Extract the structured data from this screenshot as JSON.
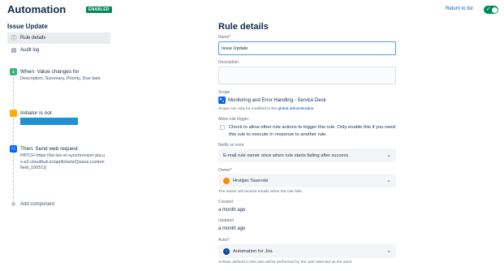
{
  "header": {
    "title": "Automation",
    "status_badge": "ENABLED",
    "return_link": "Return to list",
    "toggle_icon": "check-icon",
    "colors": {
      "accent": "#00875a",
      "link": "#0052cc"
    }
  },
  "sidebar": {
    "rule_name": "Issue Update",
    "nav": [
      {
        "label": "Rule details",
        "icon": "info-icon",
        "active": true
      },
      {
        "label": "Audit log",
        "icon": "document-icon",
        "active": false
      }
    ],
    "components": [
      {
        "title": "When: Value changes for",
        "desc": "Description, Summary, Priority, Due date",
        "icon_color": "#36b37e"
      },
      {
        "title": "Initiator is not",
        "icon_color": "#ffab00"
      },
      {
        "title": "Then: Send web request",
        "desc": "PATCH https://tst-iwc-el-synchronizer-jira.us-e2.cloudhub.io/api/tickets/{{issue.customfield_10051}}",
        "icon_color": "#0065ff"
      }
    ],
    "add_component": "Add component"
  },
  "form": {
    "heading": "Rule details",
    "name_label": "Name",
    "name_value": "Issue Update",
    "description_label": "Description",
    "scope_label": "Scope",
    "scope_value": "Monitoring and Error Handling - Service Desk",
    "scope_note_prefix": "Scope can only be modified in the ",
    "scope_note_link": "global administration",
    "scope_note_suffix": ".",
    "allow_trigger_label": "Allow rule trigger",
    "allow_trigger_text": "Check to allow other rule actions to trigger this rule. Only enable this if you need this rule to execute in response to another rule.",
    "notify_label": "Notify on error",
    "notify_value": "E-mail rule owner once when rule starts failing after success",
    "owner_label": "Owner",
    "owner_value": "Hrstijan Tasevski",
    "owner_note": "The owner will receive emails when the rule fails.",
    "created_label": "Created",
    "created_value": "a month ago",
    "updated_label": "Updated",
    "updated_value": "a month ago",
    "actor_label": "Actor",
    "actor_value": "Automation for Jira",
    "actor_note": "Actions defined in this rule will be performed by the user selected as the actor.",
    "required_marker": "*"
  }
}
